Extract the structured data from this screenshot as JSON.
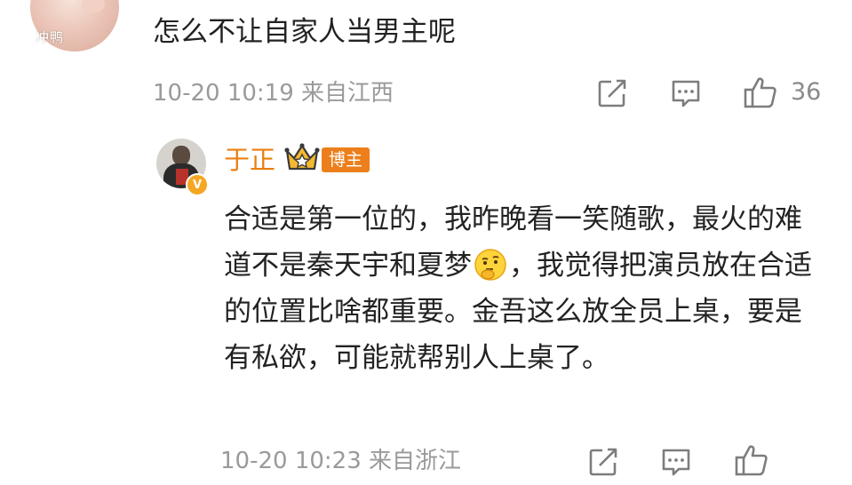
{
  "comment": {
    "avatar_label": "冲鸭",
    "text": "怎么不让自家人当男主呢",
    "meta": "10-20 10:19 来自江西",
    "like_count": "36"
  },
  "reply": {
    "name": "于正",
    "badge": "博主",
    "text_part1": "合适是第一位的，我昨晚看一笑随歌，最火的难道不是秦天宇和夏梦",
    "emoji": "思考",
    "text_part2": "，我觉得把演员放在合适的位置比啥都重要。金吾这么放全员上桌，要是有私欲，可能就帮别人上桌了。",
    "meta": "10-20 10:23 来自浙江"
  },
  "icons": {
    "share": "share-icon",
    "comment": "comment-icon",
    "like": "thumbs-up-icon"
  },
  "colors": {
    "name": "#ea7f10",
    "badge": "#ec7f1c",
    "meta": "#9a9a9a"
  }
}
